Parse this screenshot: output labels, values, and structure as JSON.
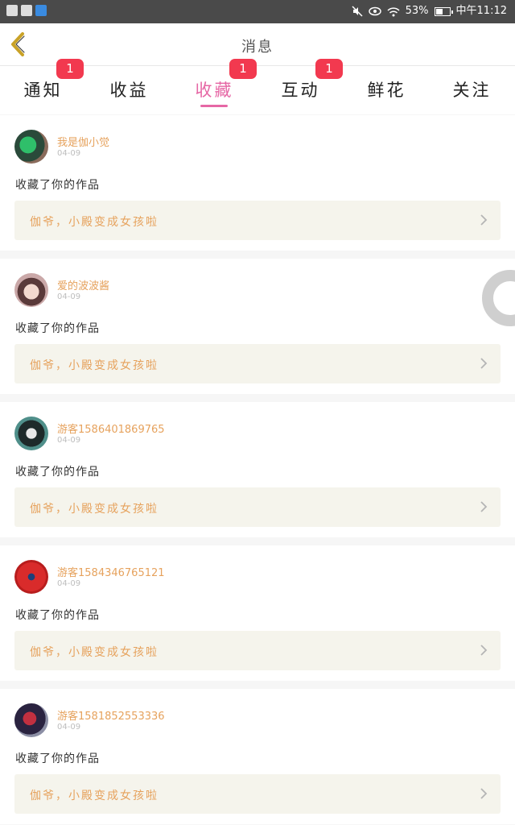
{
  "status_bar": {
    "battery": "53%",
    "battery_level": 0.53,
    "time": "中午11:12"
  },
  "header": {
    "title": "消息"
  },
  "tabs": [
    {
      "label": "通知",
      "badge": "1"
    },
    {
      "label": "收益",
      "badge": ""
    },
    {
      "label": "收藏",
      "badge": "1",
      "active": true
    },
    {
      "label": "互动",
      "badge": "1"
    },
    {
      "label": "鲜花",
      "badge": ""
    },
    {
      "label": "关注",
      "badge": ""
    }
  ],
  "notifications": [
    {
      "user": "我是伽小觉",
      "date": "04-09",
      "action": "收藏了你的作品",
      "work_title": "伽爷，小殿变成女孩啦"
    },
    {
      "user": "爱的波波酱",
      "date": "04-09",
      "action": "收藏了你的作品",
      "work_title": "伽爷，小殿变成女孩啦"
    },
    {
      "user": "游客1586401869765",
      "date": "04-09",
      "action": "收藏了你的作品",
      "work_title": "伽爷，小殿变成女孩啦"
    },
    {
      "user": "游客1584346765121",
      "date": "04-09",
      "action": "收藏了你的作品",
      "work_title": "伽爷，小殿变成女孩啦"
    },
    {
      "user": "游客1581852553336",
      "date": "04-09",
      "action": "收藏了你的作品",
      "work_title": "伽爷，小殿变成女孩啦"
    }
  ],
  "icons": {
    "back": "chevron-left-icon",
    "chevron": "chevron-right-icon",
    "mute": "mute-icon",
    "eye": "eye-icon",
    "wifi": "wifi-icon",
    "battery": "battery-icon"
  },
  "colors": {
    "accent": "#e667a5",
    "badge": "#f2394f",
    "username": "#e6a25d",
    "back_arrow": "#c9a227"
  }
}
